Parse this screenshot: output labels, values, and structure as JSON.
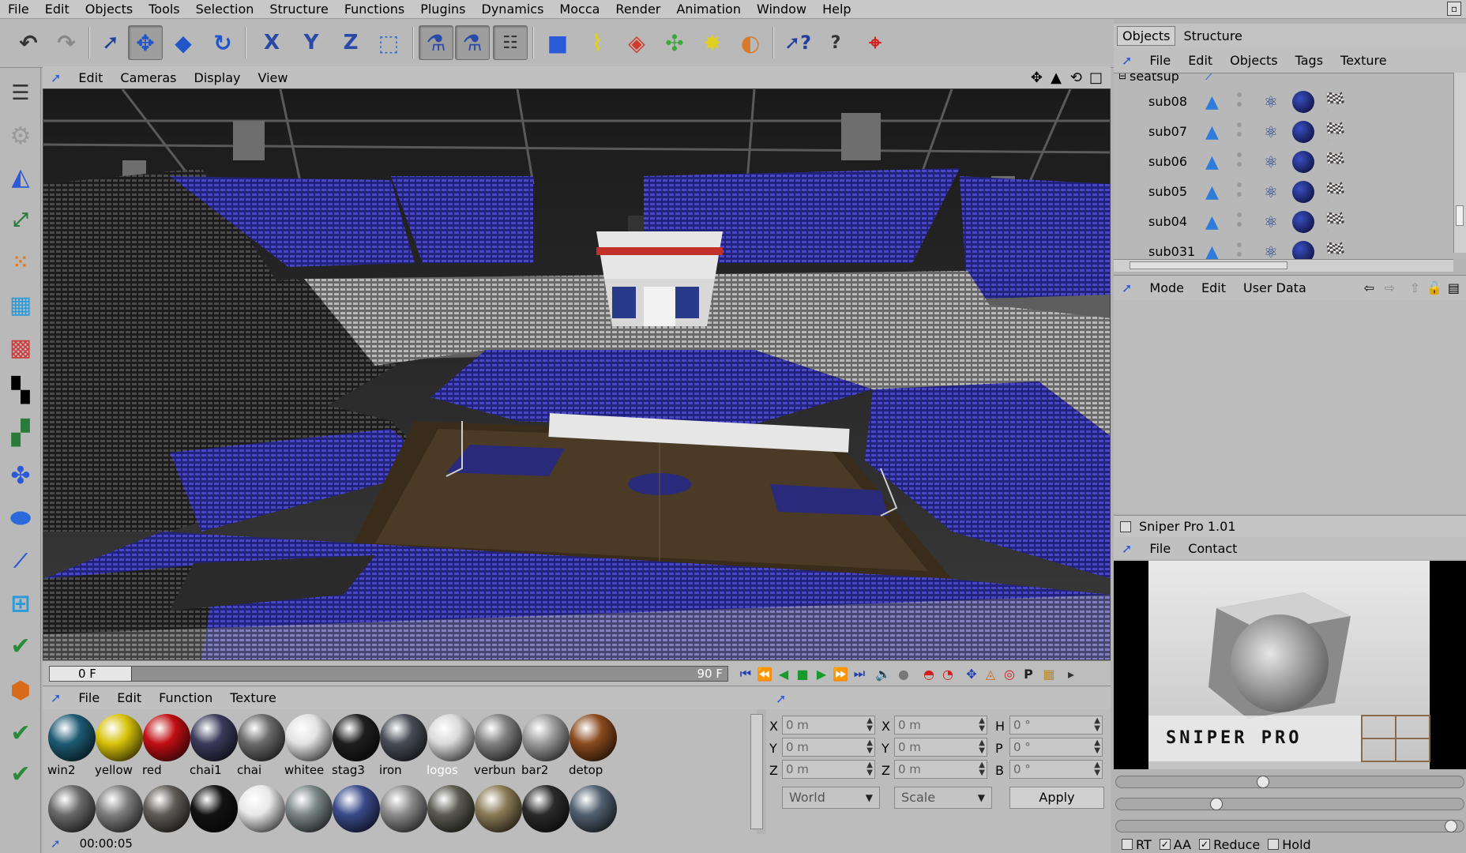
{
  "menubar": [
    "File",
    "Edit",
    "Objects",
    "Tools",
    "Selection",
    "Structure",
    "Functions",
    "Plugins",
    "Dynamics",
    "Mocca",
    "Render",
    "Animation",
    "Window",
    "Help"
  ],
  "viewport": {
    "menu": [
      "Edit",
      "Cameras",
      "Display",
      "View"
    ]
  },
  "timeline": {
    "current_frame": "0 F",
    "end_frame": "90 F"
  },
  "materials": {
    "menu": [
      "File",
      "Edit",
      "Function",
      "Texture"
    ],
    "row1": [
      {
        "name": "win2",
        "color": "#1d5a73"
      },
      {
        "name": "yellow",
        "color": "#d8c20a"
      },
      {
        "name": "red",
        "color": "#c10f14"
      },
      {
        "name": "chai1",
        "color": "#3a3a5a"
      },
      {
        "name": "chai",
        "color": "#6a6a6a"
      },
      {
        "name": "whitee",
        "color": "#e2e2e2"
      },
      {
        "name": "stag3",
        "color": "#1e1e1e"
      },
      {
        "name": "iron",
        "color": "#474c55"
      },
      {
        "name": "logos",
        "color": "#d9d9d9",
        "selected": true
      },
      {
        "name": "verbun",
        "color": "#808080"
      },
      {
        "name": "bar2",
        "color": "#9a9a9a"
      },
      {
        "name": "detop",
        "color": "#8a4a1e"
      }
    ],
    "row2_colors": [
      "#6a6a6a",
      "#7e7e7e",
      "#5e5a55",
      "#121212",
      "#e8e8e8",
      "#7a8585",
      "#3a4a8a",
      "#8a8a8a",
      "#5a5a50",
      "#8a7a55",
      "#2a2a2a",
      "#506070"
    ]
  },
  "coordinates": {
    "rows": [
      {
        "a": "X",
        "a_val": "0 m",
        "b": "X",
        "b_val": "0 m",
        "c": "H",
        "c_val": "0 °"
      },
      {
        "a": "Y",
        "a_val": "0 m",
        "b": "Y",
        "b_val": "0 m",
        "c": "P",
        "c_val": "0 °"
      },
      {
        "a": "Z",
        "a_val": "0 m",
        "b": "Z",
        "b_val": "0 m",
        "c": "B",
        "c_val": "0 °"
      }
    ],
    "mode_dropdown": "World",
    "scale_dropdown": "Scale",
    "apply": "Apply"
  },
  "status": {
    "time": "00:00:05"
  },
  "objects_panel": {
    "tabs": [
      "Objects",
      "Structure"
    ],
    "menu": [
      "File",
      "Edit",
      "Objects",
      "Tags",
      "Texture"
    ],
    "parent": "seatsup",
    "items": [
      "sub08",
      "sub07",
      "sub06",
      "sub05",
      "sub04",
      "sub031"
    ]
  },
  "attributes_panel": {
    "menu": [
      "Mode",
      "Edit",
      "User Data"
    ]
  },
  "sniper": {
    "title": "Sniper Pro 1.01",
    "menu": [
      "File",
      "Contact"
    ],
    "logo_text": "SNIPER PRO",
    "options": [
      "RT",
      "AA",
      "Reduce",
      "Hold"
    ],
    "sliders": [
      0.42,
      0.28,
      0.98
    ]
  }
}
